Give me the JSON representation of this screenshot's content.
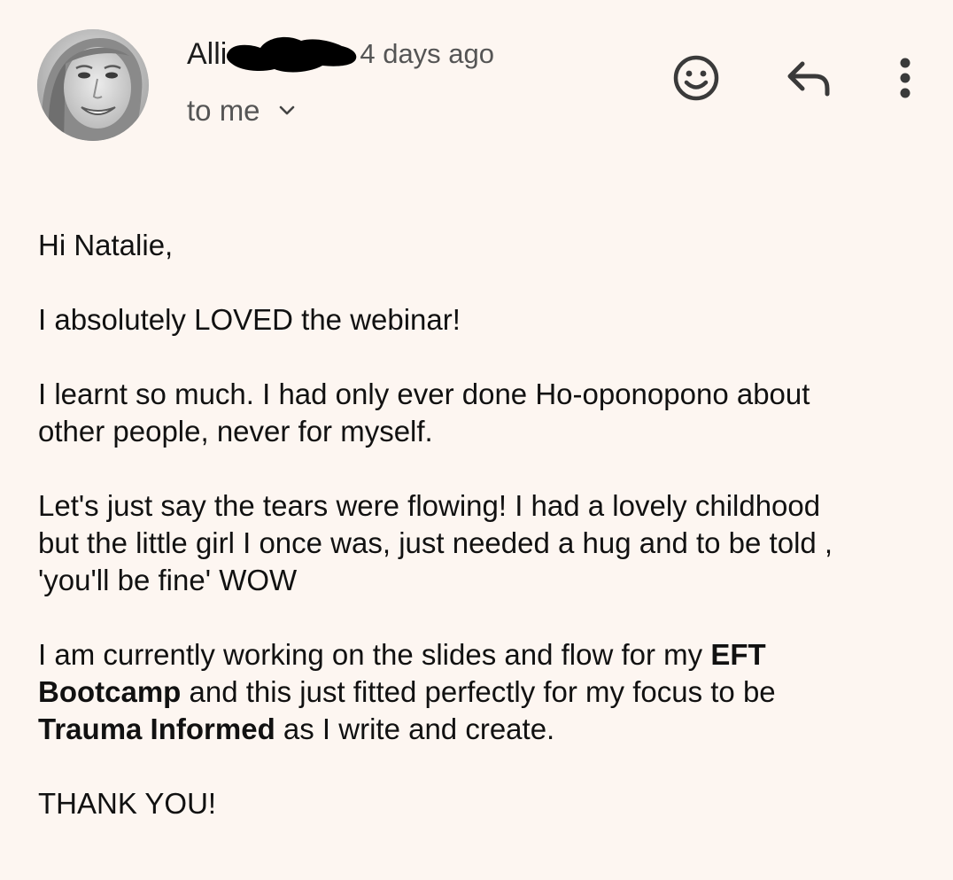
{
  "email": {
    "sender_visible": "Alli",
    "time_ago": "4 days ago",
    "recipient_label": "to me",
    "actions": {
      "emoji_icon": "smiley-face-icon",
      "reply_icon": "reply-arrow-icon",
      "more_icon": "vertical-dots-icon"
    },
    "body": {
      "greeting": "Hi Natalie,",
      "p1": "I absolutely LOVED the webinar!",
      "p2_line1": "I learnt so much. I had only ever done Ho-oponopono about",
      "p2_line2": "other people, never for myself.",
      "p3_line1": "Let's just say the tears were flowing! I had a lovely childhood",
      "p3_line2": "but the little girl I once was, just needed a hug and to be told ,",
      "p3_line3": "'you'll be fine' WOW",
      "p4_part1": "I am currently working on the slides and flow for my ",
      "p4_bold1": "EFT",
      "p4_bold2": "Bootcamp",
      "p4_part2": " and this just fitted perfectly for my focus to be",
      "p4_bold3": "Trauma Informed",
      "p4_part3": " as I write and create.",
      "closing": "THANK YOU!"
    }
  },
  "colors": {
    "background": "#fdf6f1",
    "primary_text": "#111111",
    "secondary_text": "#555555",
    "redaction": "#000000"
  }
}
